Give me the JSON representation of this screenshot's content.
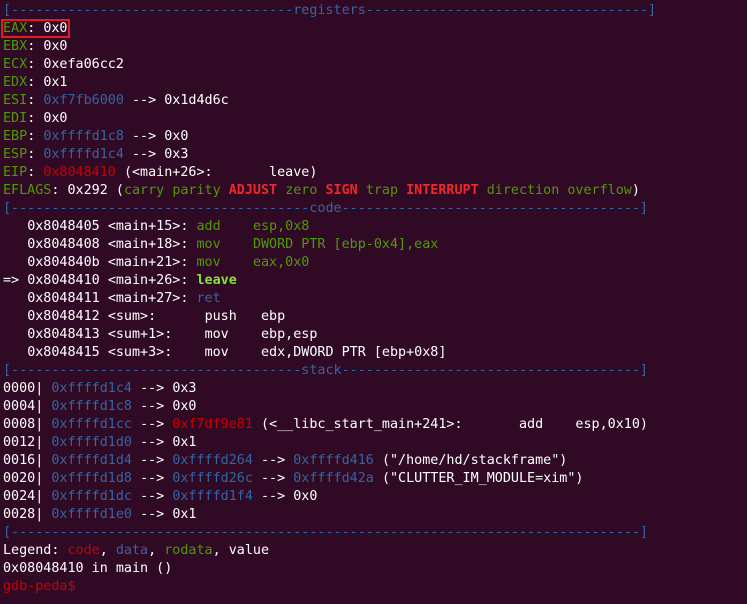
{
  "sep": {
    "registers": "[-----------------------------------registers-----------------------------------]",
    "code": "[-------------------------------------code-------------------------------------]",
    "stack": "[------------------------------------stack-------------------------------------]",
    "end": "[------------------------------------------------------------------------------]"
  },
  "registers": {
    "eax": {
      "name": "EAX",
      "value": "0x0"
    },
    "ebx": {
      "name": "EBX",
      "value": "0x0"
    },
    "ecx": {
      "name": "ECX",
      "value": "0xefa06cc2"
    },
    "edx": {
      "name": "EDX",
      "value": "0x1"
    },
    "esi": {
      "name": "ESI",
      "addr": "0xf7fb6000",
      "arrow": "-->",
      "value": "0x1d4d6c"
    },
    "edi": {
      "name": "EDI",
      "value": "0x0"
    },
    "ebp": {
      "name": "EBP",
      "addr": "0xffffd1c8",
      "arrow": "-->",
      "value": "0x0"
    },
    "esp": {
      "name": "ESP",
      "addr": "0xffffd1c4",
      "arrow": "-->",
      "value": "0x3"
    },
    "eip": {
      "name": "EIP",
      "addr": "0x8048410",
      "sym": "(<main+26>:",
      "instr": "leave)"
    },
    "eflags": {
      "name": "EFLAGS",
      "value": "0x292",
      "open": "(",
      "flags": [
        "carry",
        "parity",
        "ADJUST",
        "zero",
        "SIGN",
        "trap",
        "INTERRUPT",
        "direction",
        "overflow"
      ],
      "close": ")"
    }
  },
  "code": [
    {
      "prefix": "   ",
      "addr": "0x8048405",
      "sym": "<main+15>:",
      "mn": "add",
      "ops": "esp,0x8"
    },
    {
      "prefix": "   ",
      "addr": "0x8048408",
      "sym": "<main+18>:",
      "mn": "mov",
      "ops": "DWORD PTR [ebp-0x4],eax"
    },
    {
      "prefix": "   ",
      "addr": "0x804840b",
      "sym": "<main+21>:",
      "mn": "mov",
      "ops": "eax,0x0"
    },
    {
      "prefix": "=> ",
      "addr": "0x8048410",
      "sym": "<main+26>:",
      "mn": "leave",
      "ops": ""
    },
    {
      "prefix": "   ",
      "addr": "0x8048411",
      "sym": "<main+27>:",
      "mn": "ret",
      "ops": ""
    },
    {
      "prefix": "   ",
      "addr": "0x8048412",
      "sym": "<sum>:",
      "mn": "push",
      "ops": "ebp"
    },
    {
      "prefix": "   ",
      "addr": "0x8048413",
      "sym": "<sum+1>:",
      "mn": "mov",
      "ops": "ebp,esp"
    },
    {
      "prefix": "   ",
      "addr": "0x8048415",
      "sym": "<sum+3>:",
      "mn": "mov",
      "ops": "edx,DWORD PTR [ebp+0x8]"
    }
  ],
  "stack": [
    {
      "off": "0000|",
      "addr": "0xffffd1c4",
      "arrow": "-->",
      "v1": "0x3"
    },
    {
      "off": "0004|",
      "addr": "0xffffd1c8",
      "arrow": "-->",
      "v1": "0x0"
    },
    {
      "off": "0008|",
      "addr": "0xffffd1cc",
      "arrow": "-->",
      "v1": "0xf7df9e81",
      "rest": "(<__libc_start_main+241>:       add    esp,0x10)"
    },
    {
      "off": "0012|",
      "addr": "0xffffd1d0",
      "arrow": "-->",
      "v1": "0x1"
    },
    {
      "off": "0016|",
      "addr": "0xffffd1d4",
      "arrow": "-->",
      "v1": "0xffffd264",
      "arrow2": "-->",
      "v2": "0xffffd416",
      "rest": "(\"/home/hd/stackframe\")"
    },
    {
      "off": "0020|",
      "addr": "0xffffd1d8",
      "arrow": "-->",
      "v1": "0xffffd26c",
      "arrow2": "-->",
      "v2": "0xffffd42a",
      "rest": "(\"CLUTTER_IM_MODULE=xim\")"
    },
    {
      "off": "0024|",
      "addr": "0xffffd1dc",
      "arrow": "-->",
      "v1": "0xffffd1f4",
      "arrow2": "-->",
      "v2": "0x0"
    },
    {
      "off": "0028|",
      "addr": "0xffffd1e0",
      "arrow": "-->",
      "v1": "0x1"
    }
  ],
  "legend": {
    "label": "Legend:",
    "code": "code",
    "data": "data",
    "rodata": "rodata",
    "value": "value"
  },
  "location": "0x08048410 in main ()",
  "prompt": "gdb-peda$"
}
